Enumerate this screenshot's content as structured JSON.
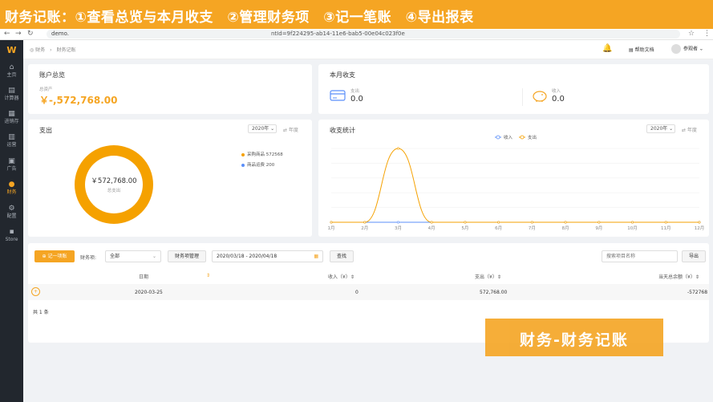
{
  "banner": {
    "text": "财务记账：①查看总览与本月收支　②管理财务项　③记一笔账　④导出报表"
  },
  "browser": {
    "back": "←",
    "forward": "→",
    "reload": "↻",
    "url": "demo.",
    "url_tail": "ntId=9f224295-ab14-11e6-bab5-00e04c023f0e",
    "star": "☆",
    "menu": "⋮"
  },
  "sidebar": {
    "logo": "W",
    "items": [
      {
        "label": "主页",
        "icon": "⌂"
      },
      {
        "label": "计算器",
        "icon": "▤"
      },
      {
        "label": "进销存",
        "icon": "▦"
      },
      {
        "label": "运营",
        "icon": "▥"
      },
      {
        "label": "广告",
        "icon": "▣"
      },
      {
        "label": "财务",
        "icon": "●"
      },
      {
        "label": "配置",
        "icon": "⚙"
      },
      {
        "label": "Store",
        "icon": "▪"
      }
    ]
  },
  "topbar": {
    "breadcrumb": "◎ 财务　›　财务记账",
    "bell": "🔔",
    "help": "▤ 帮助文档",
    "user": "参观者 ⌄"
  },
  "overview": {
    "title": "账户总览",
    "total_label": "总资产",
    "total_amount": "￥-,572,768.00"
  },
  "monthly": {
    "title": "本月收支",
    "expense_label": "支出",
    "expense_value": "0.0",
    "income_label": "收入",
    "income_value": "0.0"
  },
  "expense_card": {
    "title": "支出",
    "year_select": "2020年 ⌄",
    "toggle": "⇄ 年度",
    "center_value": "￥572,768.00",
    "center_label": "总支出",
    "legend": [
      {
        "label": "采购商品 572568",
        "color": "#f5a100"
      },
      {
        "label": "商品运费 200",
        "color": "#5b8ff9"
      }
    ]
  },
  "stats_card": {
    "title": "收支统计",
    "year_select": "2020年 ⌄",
    "toggle": "⇄ 年度",
    "legend_income": "收入",
    "legend_expense": "支出"
  },
  "chart_data": {
    "type": "line",
    "categories": [
      "1月",
      "2月",
      "3月",
      "4月",
      "5月",
      "6月",
      "7月",
      "8月",
      "9月",
      "10月",
      "11月",
      "12月"
    ],
    "series": [
      {
        "name": "收入",
        "values": [
          0,
          0,
          0,
          0,
          0,
          0,
          0,
          0,
          0,
          0,
          0,
          0
        ],
        "color": "#5b8ff9"
      },
      {
        "name": "支出",
        "values": [
          0,
          0,
          572768,
          0,
          0,
          0,
          0,
          0,
          0,
          0,
          0,
          0
        ],
        "color": "#f5a100"
      }
    ],
    "smooth": true,
    "grid": true,
    "legend_position": "top-left"
  },
  "toolbar": {
    "add_label": "⊕ 记一项账",
    "item_label": "财务项:",
    "item_select": "全部",
    "manage_label": "财务项管理",
    "date_range": "2020/03/18 - 2020/04/18",
    "search_label": "查找",
    "search_placeholder": "搜索项目名称",
    "export_label": "导出"
  },
  "table": {
    "headers": {
      "date": "日期",
      "sort": "⇕",
      "income": "收入（¥）⇕",
      "expense": "支出（¥）⇕",
      "balance": "当天总余额（¥）⇕"
    },
    "rows": [
      {
        "icon": "+",
        "date": "2020-03-25",
        "income": "0",
        "expense": "572,768.00",
        "balance": "-572768"
      }
    ],
    "count": "共 1 条"
  },
  "caption": {
    "text": "财务-财务记账"
  }
}
